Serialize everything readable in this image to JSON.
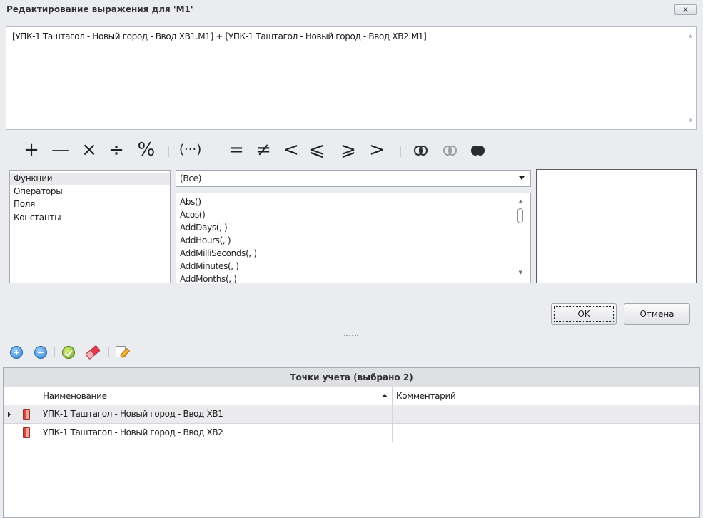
{
  "window": {
    "title": "Редактирование выражения для 'M1'",
    "close_label": "x"
  },
  "expression": {
    "text": "[УПК-1 Таштагол - Новый город - Ввод ХВ1.M1] + [УПК-1 Таштагол - Новый город - Ввод ХВ2.M1]"
  },
  "operators": {
    "plus": "+",
    "minus": "—",
    "multiply": "×",
    "divide": "÷",
    "modulo": "%",
    "parens": "(···)",
    "equal": "=",
    "not_equal": "≠",
    "less": "<",
    "less_equal": "⩽",
    "greater_equal": "⩾",
    "greater": ">"
  },
  "categories": [
    {
      "label": "Функции",
      "selected": true
    },
    {
      "label": "Операторы",
      "selected": false
    },
    {
      "label": "Поля",
      "selected": false
    },
    {
      "label": "Константы",
      "selected": false
    }
  ],
  "filter": {
    "value": "(Все)"
  },
  "functions": [
    "Abs()",
    "Acos()",
    "AddDays(, )",
    "AddHours(, )",
    "AddMilliSeconds(, )",
    "AddMinutes(, )",
    "AddMonths(, )"
  ],
  "buttons": {
    "ok": "OK",
    "cancel": "Отмена"
  },
  "toolbar": {
    "icons": [
      "add-icon",
      "remove-icon",
      "check-icon",
      "eraser-icon",
      "edit-icon"
    ]
  },
  "grid": {
    "caption": "Точки учета (выбрано 2)",
    "columns": {
      "name": "Наименование",
      "comment": "Комментарий"
    },
    "rows": [
      {
        "name": "УПК-1 Таштагол - Новый город - Ввод ХВ1",
        "comment": ""
      },
      {
        "name": "УПК-1 Таштагол - Новый город - Ввод ХВ2",
        "comment": ""
      }
    ]
  }
}
